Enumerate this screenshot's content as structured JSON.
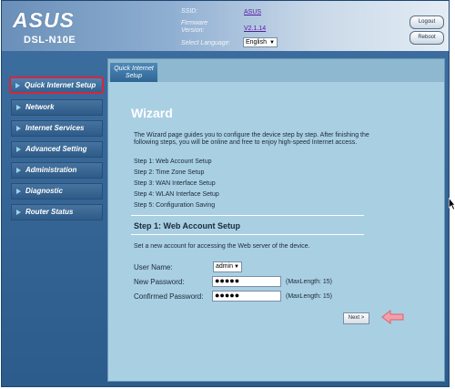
{
  "header": {
    "logo": "ASUS",
    "model": "DSL-N10E",
    "ssid_label": "SSID:",
    "ssid_value": "ASUS",
    "firmware_label_1": "Firmware",
    "firmware_label_2": "Version:",
    "firmware_value": "V2.1.14",
    "language_label": "Select Language:",
    "language_value": "English",
    "logout_label": "Logout",
    "reboot_label": "Reboot"
  },
  "sidebar": {
    "items": [
      {
        "label": "Quick Internet Setup",
        "active": true
      },
      {
        "label": "Network"
      },
      {
        "label": "Internet Services"
      },
      {
        "label": "Advanced Setting"
      },
      {
        "label": "Administration"
      },
      {
        "label": "Diagnostic"
      },
      {
        "label": "Router Status"
      }
    ]
  },
  "tab": {
    "line1": "Quick Internet",
    "line2": "Setup"
  },
  "wizard": {
    "title": "Wizard",
    "description": "The Wizard page guides you to configure the device step by step. After finishing the following steps, you will be online and free to enjoy high-speed Internet access.",
    "steps": [
      "Step 1: Web Account Setup",
      "Step 2: Time Zone Setup",
      "Step 3: WAN Interface Setup",
      "Step 4: WLAN Interface Setup",
      "Step 5: Configuration Saving"
    ]
  },
  "account": {
    "title": "Step 1: Web Account Setup",
    "description": "Set a new account for accessing the Web server of the device.",
    "username_label": "User Name:",
    "username_value": "admin",
    "new_password_label": "New Password:",
    "new_password_value": "●●●●●",
    "confirm_password_label": "Confirmed Password:",
    "confirm_password_value": "●●●●●",
    "maxlength_note": "(MaxLength: 15)",
    "next_label": "Next >"
  },
  "colors": {
    "accent_highlight": "#d7263d",
    "pointer_arrow": "#f0a0a8",
    "panel_bg": "#a9cfe2"
  }
}
